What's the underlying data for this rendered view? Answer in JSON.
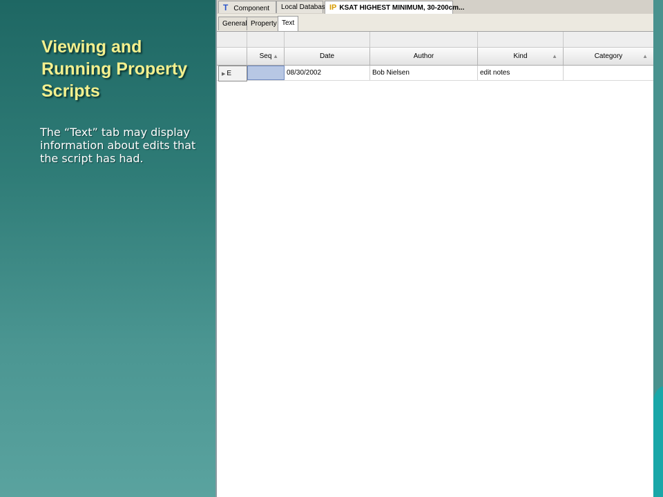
{
  "slide": {
    "title_lines": [
      "Viewing and",
      "Running Property",
      "Scripts"
    ],
    "body": "The “Text” tab may display information about edits that the script has had."
  },
  "window": {
    "doc_tabs": [
      {
        "icon": "T",
        "label": "Component"
      },
      {
        "icon": "",
        "label": "Local Database"
      },
      {
        "icon": "IP",
        "label": "KSAT HIGHEST MINIMUM, 30-200cm..."
      }
    ],
    "sub_tabs": [
      "General",
      "Property",
      "Text"
    ],
    "active_sub_tab": "Text"
  },
  "grid": {
    "columns": [
      "Seq",
      "Date",
      "Author",
      "Kind",
      "Category"
    ],
    "rows": [
      {
        "marker": "E",
        "seq": "",
        "date": "08/30/2002",
        "author": "Bob Nielsen",
        "kind": "edit notes",
        "category": ""
      }
    ]
  },
  "colors": {
    "title": "#f3f08e",
    "background_top": "#1e6763",
    "background_bottom": "#5aa39f",
    "selection": "#b7c7e4"
  }
}
